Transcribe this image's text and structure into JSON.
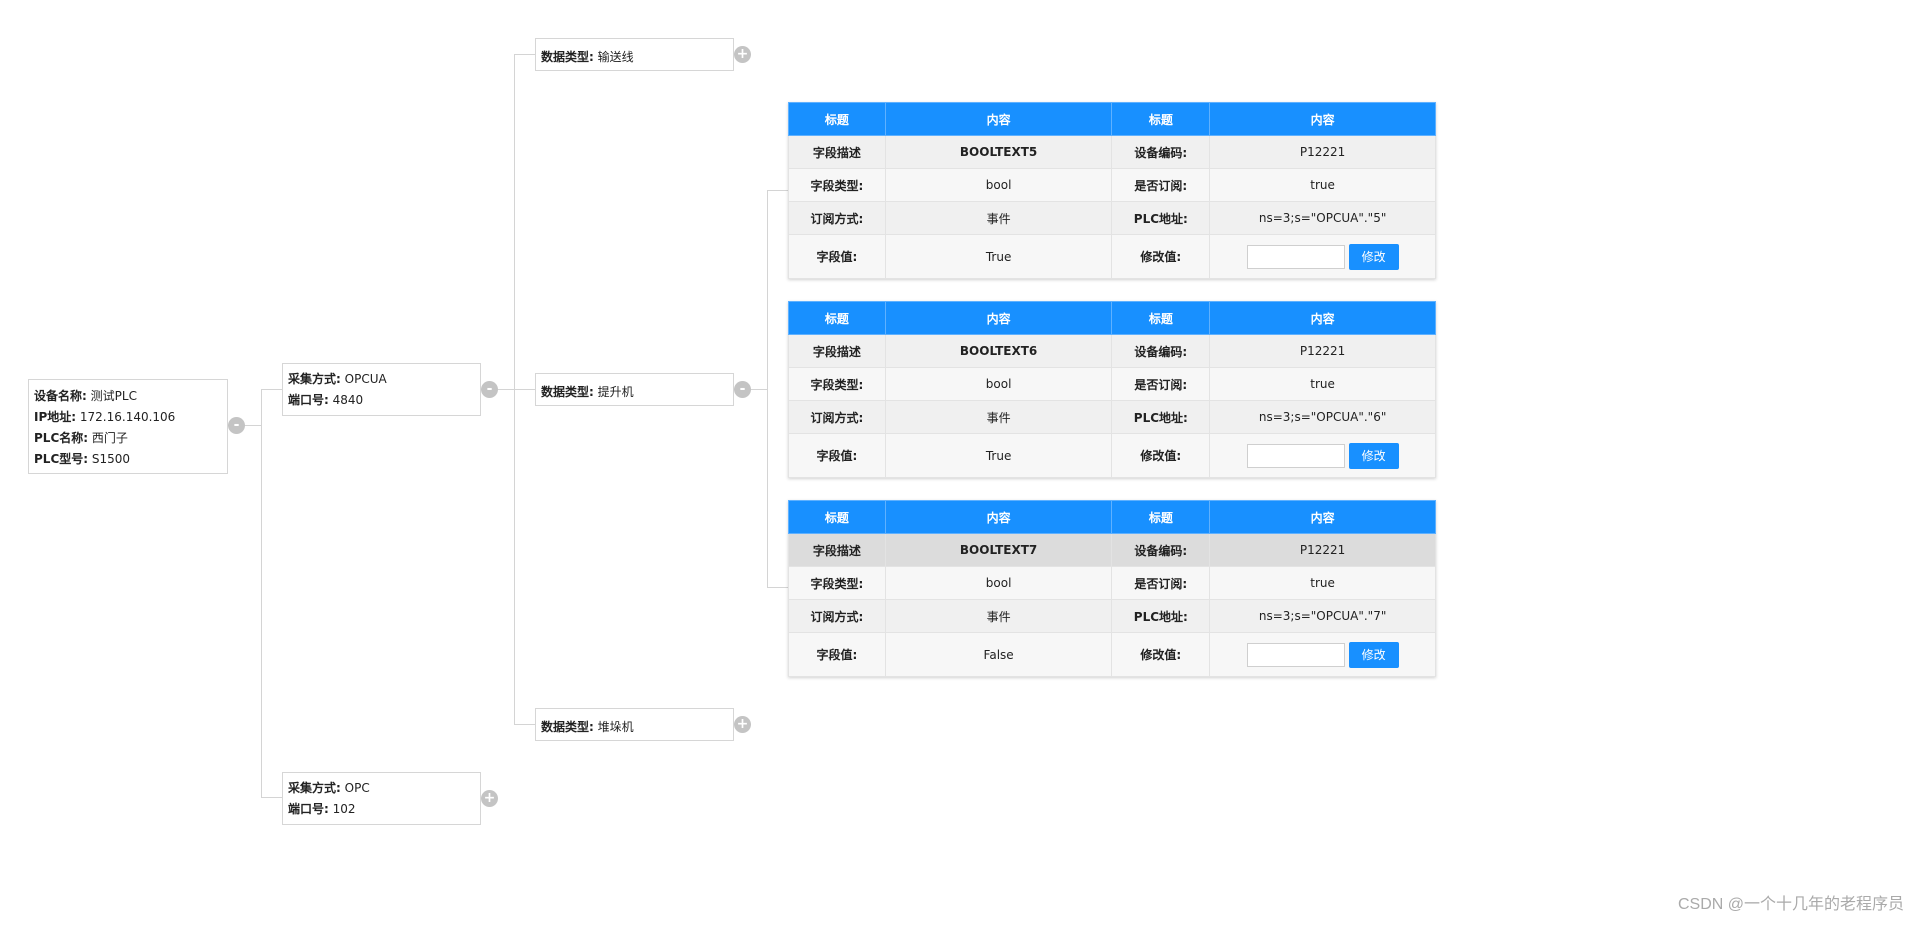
{
  "device": {
    "name_label": "设备名称:",
    "name": "测试PLC",
    "ip_label": "IP地址:",
    "ip": "172.16.140.106",
    "plc_name_label": "PLC名称:",
    "plc_name": "西门子",
    "plc_model_label": "PLC型号:",
    "plc_model": "S1500"
  },
  "collections": [
    {
      "method_label": "采集方式:",
      "method": "OPCUA",
      "port_label": "端口号:",
      "port": "4840",
      "toggle": "-"
    },
    {
      "method_label": "采集方式:",
      "method": "OPC",
      "port_label": "端口号:",
      "port": "102",
      "toggle": "+"
    }
  ],
  "data_types": [
    {
      "label": "数据类型:",
      "value": "输送线",
      "toggle": "+"
    },
    {
      "label": "数据类型:",
      "value": "提升机",
      "toggle": "-"
    },
    {
      "label": "数据类型:",
      "value": "堆垛机",
      "toggle": "+"
    }
  ],
  "device_toggle": "-",
  "table_headers": [
    "标题",
    "内容",
    "标题",
    "内容"
  ],
  "tables": [
    {
      "rows": [
        {
          "l1": "字段描述",
          "v1": "BOOLTEXT5",
          "l2": "设备编码:",
          "v2": "P12221"
        },
        {
          "l1": "字段类型:",
          "v1": "bool",
          "l2": "是否订阅:",
          "v2": "true"
        },
        {
          "l1": "订阅方式:",
          "v1": "事件",
          "l2": "PLC地址:",
          "v2": "ns=3;s=\"OPCUA\".\"5\""
        }
      ],
      "value_label": "字段值:",
      "value": "True",
      "edit_label": "修改值:",
      "input_value": "",
      "button": "修改"
    },
    {
      "rows": [
        {
          "l1": "字段描述",
          "v1": "BOOLTEXT6",
          "l2": "设备编码:",
          "v2": "P12221"
        },
        {
          "l1": "字段类型:",
          "v1": "bool",
          "l2": "是否订阅:",
          "v2": "true"
        },
        {
          "l1": "订阅方式:",
          "v1": "事件",
          "l2": "PLC地址:",
          "v2": "ns=3;s=\"OPCUA\".\"6\""
        }
      ],
      "value_label": "字段值:",
      "value": "True",
      "edit_label": "修改值:",
      "input_value": "",
      "button": "修改"
    },
    {
      "rows": [
        {
          "l1": "字段描述",
          "v1": "BOOLTEXT7",
          "l2": "设备编码:",
          "v2": "P12221"
        },
        {
          "l1": "字段类型:",
          "v1": "bool",
          "l2": "是否订阅:",
          "v2": "true"
        },
        {
          "l1": "订阅方式:",
          "v1": "事件",
          "l2": "PLC地址:",
          "v2": "ns=3;s=\"OPCUA\".\"7\""
        }
      ],
      "value_label": "字段值:",
      "value": "False",
      "edit_label": "修改值:",
      "input_value": "",
      "button": "修改"
    }
  ],
  "watermark": "CSDN @一个十几年的老程序员",
  "colors": {
    "header_blue": "#1890ff",
    "toggle_gray": "#c4c4c4",
    "connector": "#d4d4d4"
  }
}
